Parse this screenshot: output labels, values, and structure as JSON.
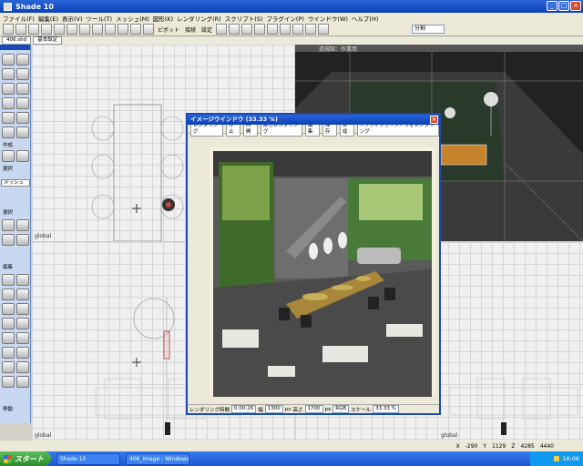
{
  "window": {
    "title": "Shade 10"
  },
  "menubar": {
    "items": [
      "ファイル(F)",
      "編集(E)",
      "表示(V)",
      "ツール(T)",
      "メッシュ(M)",
      "図形(K)",
      "レンダリング(R)",
      "スクリプト(S)",
      "プラグイン(P)",
      "ウインドウ(W)",
      "ヘルプ(H)"
    ]
  },
  "toolbar": {
    "pivot_label": "ピボット",
    "attach_label": "接続",
    "settings_label": "設定",
    "select_value": "分割"
  },
  "doc_tabs": [
    "406.shd",
    "基本設定"
  ],
  "palette": {
    "section_create": "作成",
    "section_mesh": "メッシュ",
    "section_select": "選択",
    "section_edit": "編集",
    "section_move": "移動"
  },
  "viewports": {
    "top_left_label": "global",
    "top_right_label": "透視図：作業用",
    "bottom_left_label": "global",
    "bottom_right_label": "global"
  },
  "image_window": {
    "title": "イメージウインドウ (33.33 %)",
    "toolbar": [
      "レンダリング",
      "停止",
      "再開",
      "部分レンダリング",
      "編集",
      "保存",
      "合成",
      "アクティブウインドウをレンダリング"
    ],
    "status": {
      "time_label": "レンダリング時間",
      "time_value": "0:00:26",
      "width_label": "幅",
      "width_value": "1300",
      "width_unit": "px",
      "height_label": "高さ",
      "height_value": "1700",
      "height_unit": "px",
      "mode": "RGB",
      "scale_label": "スケール",
      "scale_value": "33.33 %"
    }
  },
  "coords": {
    "x_label": "X",
    "x_value": "-290",
    "y_label": "Y",
    "y_value": "1129",
    "z_label": "Z",
    "z_value": "4285",
    "w_value": "4440"
  },
  "taskbar": {
    "start_label": "スタート",
    "items": [
      "Shade 10",
      "406_image - Windows..."
    ],
    "clock": "16:06"
  }
}
